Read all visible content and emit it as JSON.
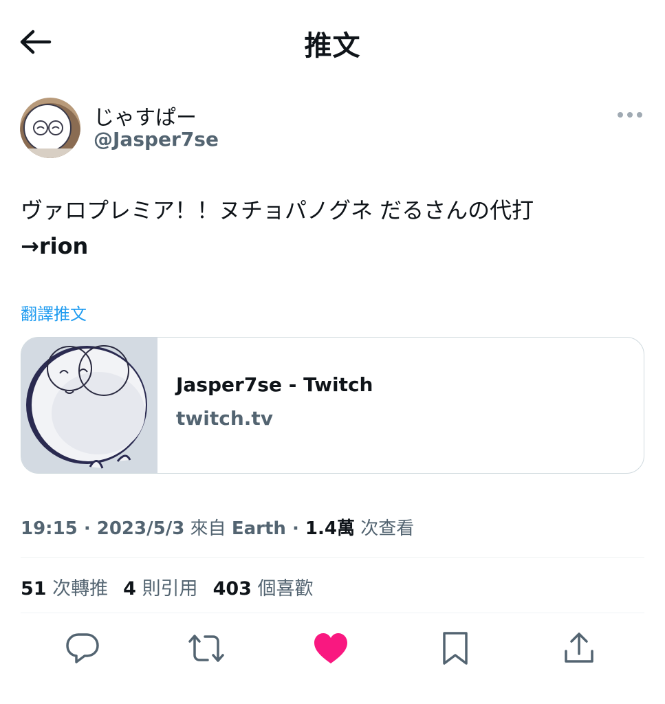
{
  "header": {
    "title": "推文",
    "back_icon": "arrow-left-icon"
  },
  "author": {
    "display_name": "じゃすぱー",
    "handle": "@Jasper7se",
    "more_icon": "more-horizontal-icon"
  },
  "tweet": {
    "text_line1": "ヴァロプレミア！！ヌチョパノグネ だるさんの代打",
    "text_line2": "→rion",
    "translate_label": "翻譯推文"
  },
  "card": {
    "title": "Jasper7se - Twitch",
    "domain": "twitch.tv"
  },
  "meta": {
    "time": "19:15",
    "sep1": " · ",
    "date": "2023/5/3",
    "source_prefix": " 來自 ",
    "source": "Earth",
    "sep2": " · ",
    "views_count": "1.4萬",
    "views_label": " 次查看"
  },
  "stats": {
    "retweets_count": "51",
    "retweets_label": "次轉推",
    "quotes_count": "4",
    "quotes_label": "則引用",
    "likes_count": "403",
    "likes_label": "個喜歡"
  },
  "actions": [
    {
      "name": "reply",
      "icon": "reply-icon"
    },
    {
      "name": "retweet",
      "icon": "retweet-icon"
    },
    {
      "name": "like",
      "icon": "heart-filled-icon",
      "active": true
    },
    {
      "name": "bookmark",
      "icon": "bookmark-icon"
    },
    {
      "name": "share",
      "icon": "share-icon"
    }
  ],
  "colors": {
    "text_primary": "#0f1419",
    "text_secondary": "#536471",
    "link": "#1d9bf0",
    "like_active": "#f91880",
    "border": "#cfd9de"
  }
}
